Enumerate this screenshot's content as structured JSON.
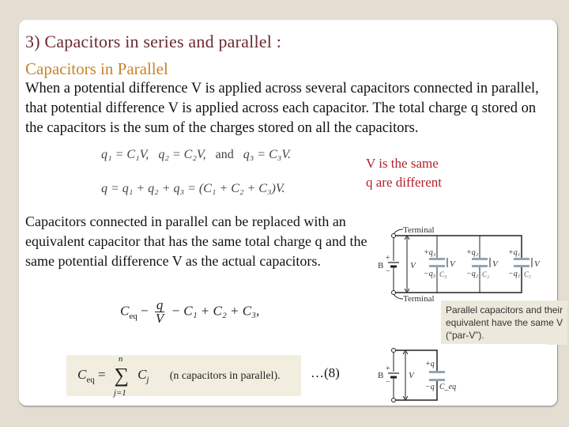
{
  "slide": {
    "title": "3) Capacitors in series and parallel :",
    "subtitle": "Capacitors in Parallel",
    "intro_paragraph": "When a potential difference V is applied across several capacitors connected in parallel, that potential difference V is applied across each capacitor. The total charge q stored on the capacitors is the sum of the charges stored on all the capacitors.",
    "equations": {
      "charges": {
        "q1": "q₁ = C₁V,",
        "q2": "q₂ = C₂V,",
        "and": "and",
        "q3": "q₃ = C₃V."
      },
      "total_charge": "q = q₁ + q₂ + q₃ = (C₁ + C₂ + C₃)V.",
      "ceq": {
        "lhs": "C",
        "lhs_sub": "eq",
        "eq1": "−",
        "num": "q",
        "den": "V",
        "rhs": "− C₁ + C₂ + C₃,"
      },
      "sum_formula": {
        "lhs": "C",
        "lhs_sub": "eq",
        "equals": "=",
        "upper": "n",
        "sigma": "∑",
        "lower": "j=1",
        "term": "C",
        "term_sub": "j",
        "description": "(n capacitors in parallel).",
        "number": "…(8)"
      }
    },
    "notes": {
      "line1": "V is the same",
      "line2": "q are different"
    },
    "equivalent_paragraph": "Capacitors connected in parallel can be replaced with an equivalent capacitor that has the same total charge q and the same potential difference V as the actual capacitors.",
    "caption": "Parallel capacitors and their equivalent have the same V (“par-V”).",
    "diagram_parallel": {
      "terminal_top": "Terminal",
      "terminal_bottom": "Terminal",
      "battery": "B",
      "plus": "+",
      "minus": "−",
      "voltage": "V",
      "capacitors": [
        {
          "plus": "+q₃",
          "minus": "−q₃",
          "label": "C₃",
          "v": "V"
        },
        {
          "plus": "+q₂",
          "minus": "−q₂",
          "label": "C₂",
          "v": "V"
        },
        {
          "plus": "+q₁",
          "minus": "−q₁",
          "label": "C₁",
          "v": "V"
        }
      ]
    },
    "diagram_equivalent": {
      "battery": "B",
      "plus": "+",
      "minus": "−",
      "voltage": "V",
      "cap_plus": "+q",
      "cap_minus": "−q",
      "cap_label": "C_eq"
    }
  },
  "colors": {
    "background": "#e3ddd2",
    "title": "#6b2a33",
    "subtitle": "#c9842c",
    "note": "#b3202a",
    "formula_box": "#f2eedf",
    "capacitor_plate": "#8fa6b5"
  }
}
